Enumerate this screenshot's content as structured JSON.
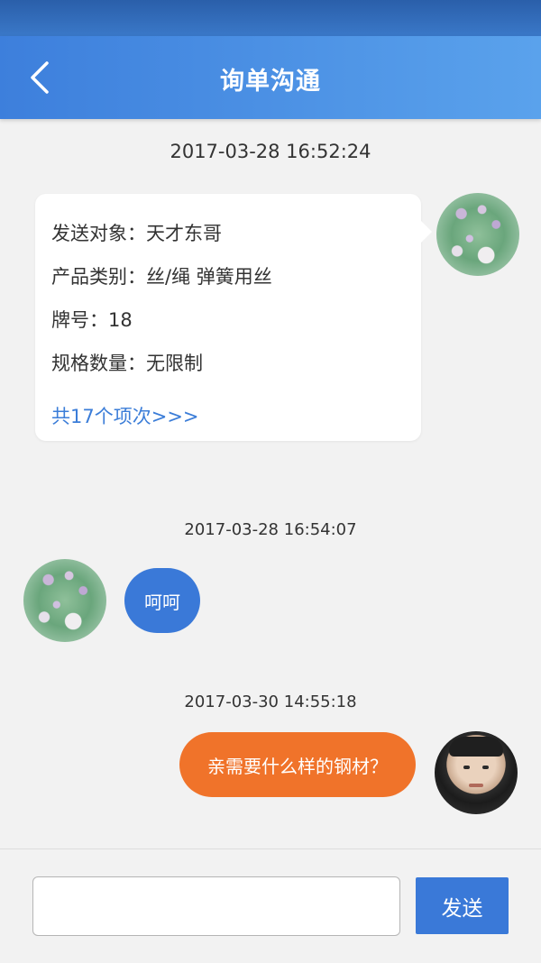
{
  "header": {
    "title": "询单沟通",
    "back_icon": "chevron-left-icon"
  },
  "colors": {
    "header_blue": "#3d7fdc",
    "bubble_blue": "#3a79d8",
    "bubble_orange": "#f0732a",
    "link_blue": "#3b7dd8"
  },
  "messages": [
    {
      "timestamp": "2017-03-28 16:52:24",
      "card": {
        "target": "发送对象：天才东哥",
        "category": "产品类别：丝/绳 弹簧用丝",
        "brand": "牌号：18",
        "spec": "规格数量：无限制",
        "link": "共17个项次>>>"
      }
    },
    {
      "timestamp": "2017-03-28 16:54:07",
      "text": "呵呵"
    },
    {
      "timestamp": "2017-03-30 14:55:18",
      "text": "亲需要什么样的钢材？"
    }
  ],
  "composer": {
    "input_value": "",
    "send_label": "发送"
  }
}
